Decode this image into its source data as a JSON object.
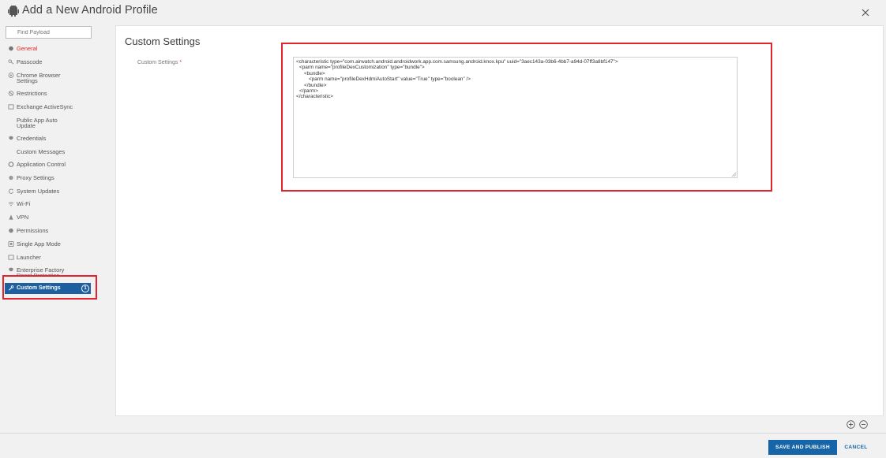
{
  "window": {
    "title": "Add a New Android Profile",
    "close_icon": "close-icon"
  },
  "sidebar": {
    "search_placeholder": "Find Payload",
    "items": [
      {
        "label": "General",
        "icon": "settings-icon"
      },
      {
        "label": "Passcode",
        "icon": "key-icon"
      },
      {
        "label": "Chrome Browser Settings",
        "icon": "chrome-icon"
      },
      {
        "label": "Restrictions",
        "icon": "restrictions-icon"
      },
      {
        "label": "Exchange ActiveSync",
        "icon": "mail-icon"
      },
      {
        "label": "Public App Auto Update",
        "icon": ""
      },
      {
        "label": "Credentials",
        "icon": "credentials-icon"
      },
      {
        "label": "Custom Messages",
        "icon": ""
      },
      {
        "label": "Application Control",
        "icon": "app-control-icon"
      },
      {
        "label": "Proxy Settings",
        "icon": "proxy-icon"
      },
      {
        "label": "System Updates",
        "icon": "refresh-icon"
      },
      {
        "label": "Wi-Fi",
        "icon": "wifi-icon"
      },
      {
        "label": "VPN",
        "icon": "lock-icon"
      },
      {
        "label": "Permissions",
        "icon": "permissions-icon"
      },
      {
        "label": "Single App Mode",
        "icon": "single-app-icon"
      },
      {
        "label": "Launcher",
        "icon": "launcher-icon"
      },
      {
        "label": "Enterprise Factory Reset Protection",
        "icon": "shield-icon"
      },
      {
        "label": "Custom Settings",
        "icon": "wrench-icon",
        "badge": "1"
      }
    ]
  },
  "main": {
    "title": "Custom Settings",
    "field_label": "Custom Settings",
    "required_marker": "*",
    "code_lines": [
      "<characteristic type=\"com.airwatch.android.androidwork.app.com.samsung.android.knox.kpu\" uuid=\"3aec143a-03b6-4bb7-a94d-07ff3a8bf147\">",
      "  <parm name=\"profileDexCustomization\" type=\"bundle\">",
      "    <bundle>",
      "      <parm name=\"profileDexHdmiAutoStart\" value=\"True\" type=\"boolean\" />",
      "    </bundle>",
      "  </parm>",
      "</characteristic>"
    ]
  },
  "footer": {
    "save_label": "SAVE AND PUBLISH",
    "cancel_label": "CANCEL"
  },
  "colors": {
    "accent": "#1565a8",
    "active_nav": "#1e5fa0",
    "highlight_box": "#e3232d",
    "general_text": "#e02b27"
  }
}
